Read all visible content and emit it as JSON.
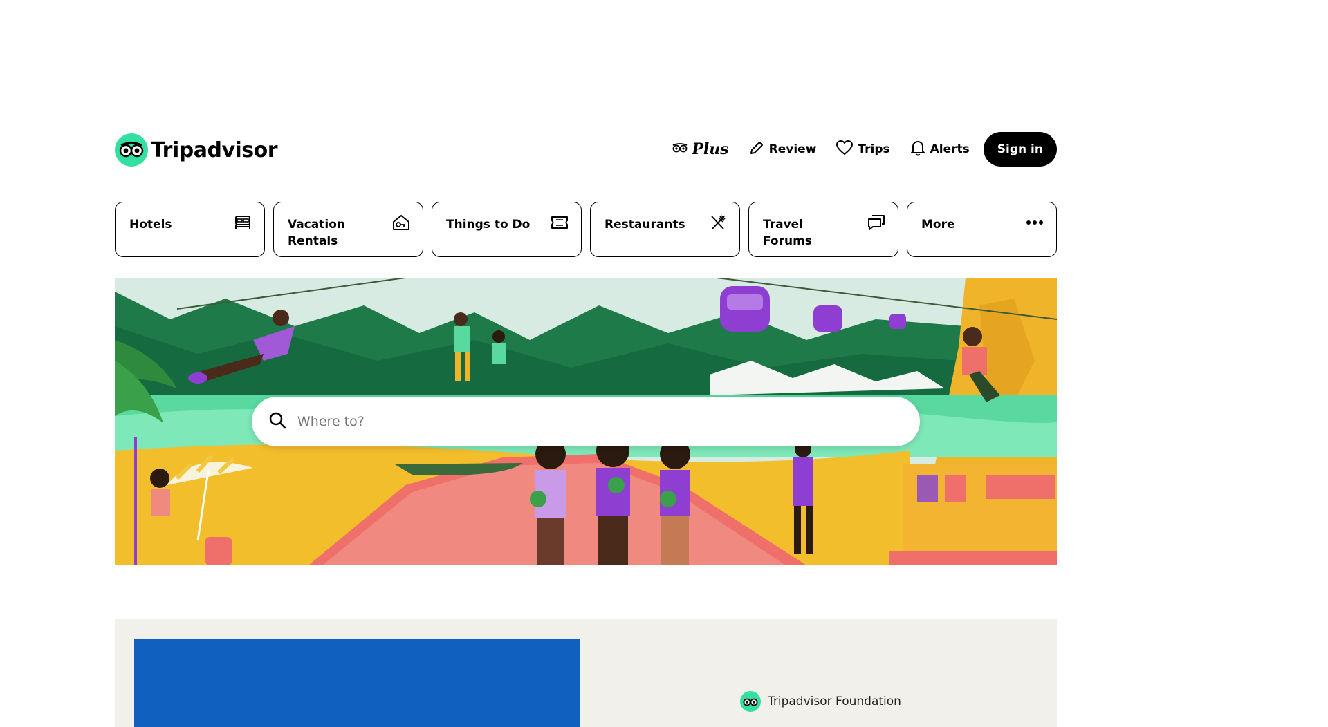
{
  "brand": {
    "name": "Tripadvisor",
    "accent_color": "#34e0a1"
  },
  "header": {
    "nav": [
      {
        "label": "Plus",
        "icon": "owl-eyes-icon"
      },
      {
        "label": "Review",
        "icon": "pencil-icon"
      },
      {
        "label": "Trips",
        "icon": "heart-icon"
      },
      {
        "label": "Alerts",
        "icon": "bell-icon"
      }
    ],
    "signin_label": "Sign in"
  },
  "categories": [
    {
      "label": "Hotels",
      "icon": "bed-icon"
    },
    {
      "label": "Vacation Rentals",
      "icon": "house-key-icon"
    },
    {
      "label": "Things to Do",
      "icon": "ticket-icon"
    },
    {
      "label": "Restaurants",
      "icon": "utensils-icon"
    },
    {
      "label": "Travel Forums",
      "icon": "chat-bubbles-icon"
    },
    {
      "label": "More",
      "icon": "more-dots-icon"
    }
  ],
  "search": {
    "placeholder": "Where to?",
    "icon": "search-icon"
  },
  "promo": {
    "brand_label": "Tripadvisor Foundation",
    "image_color": "#1060c0"
  }
}
